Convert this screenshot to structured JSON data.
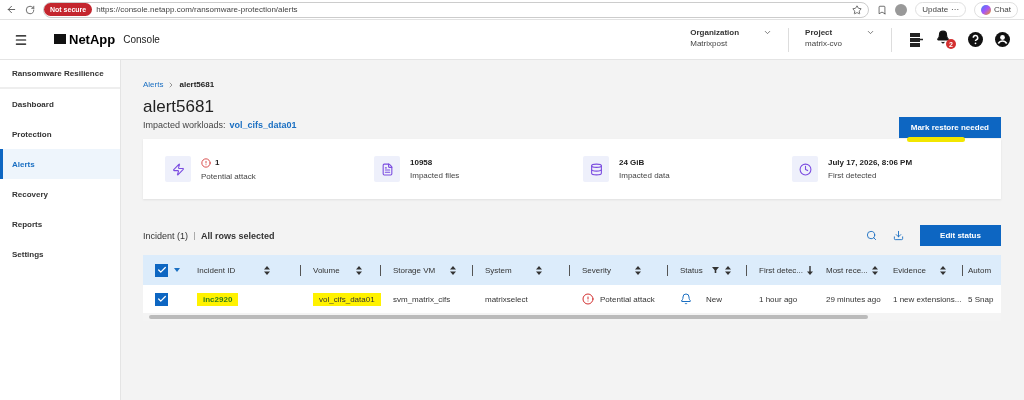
{
  "browser": {
    "security_badge": "Not secure",
    "url": "https://console.netapp.com/ransomware-protection/alerts",
    "update_label": "Update",
    "update_menu": "···",
    "chat_label": "Chat"
  },
  "header": {
    "logo": "NetApp",
    "product": "Console",
    "organization": {
      "label": "Organization",
      "value": "Matrixpost"
    },
    "project": {
      "label": "Project",
      "value": "matrix-cvo"
    },
    "notification_count": "2"
  },
  "sidebar": {
    "title": "Ransomware Resilience",
    "items": [
      {
        "label": "Dashboard",
        "selected": false
      },
      {
        "label": "Protection",
        "selected": false
      },
      {
        "label": "Alerts",
        "selected": true
      },
      {
        "label": "Recovery",
        "selected": false
      },
      {
        "label": "Reports",
        "selected": false
      },
      {
        "label": "Settings",
        "selected": false
      }
    ]
  },
  "breadcrumb": [
    {
      "label": "Alerts",
      "kind": "link"
    },
    {
      "label": "alert5681",
      "kind": "current"
    }
  ],
  "title": "alert5681",
  "impacted": {
    "label": "Impacted workloads:",
    "value": "vol_cifs_data01"
  },
  "mark_button": {
    "label": "Mark restore needed",
    "highlight_mark": true
  },
  "stats": [
    {
      "kind": "attack",
      "value": "1",
      "label": "Potential attack",
      "alert": true
    },
    {
      "kind": "files",
      "value": "10958",
      "label": "Impacted files",
      "alert": false
    },
    {
      "kind": "data",
      "value": "24 GiB",
      "label": "Impacted data",
      "alert": false
    },
    {
      "kind": "time",
      "value": "July 17, 2026, 8:06 PM",
      "label": "First detected",
      "alert": false
    }
  ],
  "incidents": {
    "count_label": "Incident (1)",
    "selection_label": "All rows selected",
    "edit_button": "Edit status",
    "all_checked": true,
    "columns": [
      {
        "label": "Incident ID",
        "sortable": true,
        "sorted": false,
        "filter": false
      },
      {
        "label": "Volume",
        "sortable": true,
        "sorted": false,
        "filter": false
      },
      {
        "label": "Storage VM",
        "sortable": true,
        "sorted": false,
        "filter": false
      },
      {
        "label": "System",
        "sortable": true,
        "sorted": false,
        "filter": false
      },
      {
        "label": "Severity",
        "sortable": true,
        "sorted": false,
        "filter": false
      },
      {
        "label": "Status",
        "sortable": true,
        "sorted": false,
        "filter": true
      },
      {
        "label": "First detec...",
        "sortable": true,
        "sorted": true,
        "filter": false
      },
      {
        "label": "Most rece...",
        "sortable": true,
        "sorted": false,
        "filter": false
      },
      {
        "label": "Evidence",
        "sortable": true,
        "sorted": false,
        "filter": false
      },
      {
        "label": "Autom",
        "sortable": false,
        "filter": false
      }
    ],
    "rows": [
      {
        "checked": true,
        "cells": [
          {
            "text": "inc2920",
            "kind": "link",
            "highlighted": true
          },
          {
            "text": "vol_cifs_data01",
            "kind": "text",
            "highlighted": true
          },
          {
            "text": "svm_matrix_cifs",
            "kind": "text",
            "highlighted": false
          },
          {
            "text": "matrixselect",
            "kind": "text",
            "highlighted": false
          },
          {
            "text": "Potential attack",
            "kind": "severity",
            "highlighted": false
          },
          {
            "text": "New",
            "kind": "status",
            "highlighted": false
          },
          {
            "text": "1 hour ago",
            "kind": "text",
            "highlighted": false
          },
          {
            "text": "29 minutes ago",
            "kind": "text",
            "highlighted": false
          },
          {
            "text": "1 new extensions...",
            "kind": "text",
            "highlighted": false
          },
          {
            "text": "5 Snap",
            "kind": "text",
            "highlighted": false
          }
        ]
      }
    ]
  }
}
